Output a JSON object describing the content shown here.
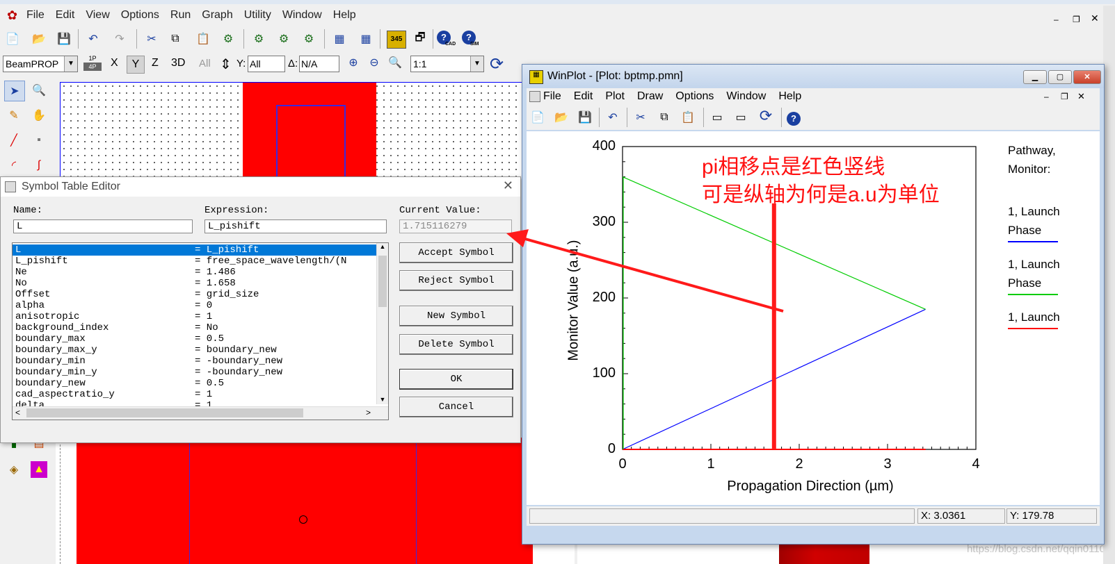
{
  "main_window": {
    "menu": [
      "File",
      "Edit",
      "View",
      "Options",
      "Run",
      "Graph",
      "Utility",
      "Window",
      "Help"
    ],
    "module_select": "BeamPROP",
    "toolbar2": {
      "p_top": "1P",
      "p_bottom": "4P",
      "x": "X",
      "y": "Y",
      "z": "Z",
      "d3": "3D",
      "all": "All",
      "y_label": "Y:",
      "y_value": "All",
      "delta_label": "Δ:",
      "delta_value": "N/A",
      "zoom_value": "1:1"
    },
    "toolbar_badges": {
      "cad": "CAD",
      "sim": "SIM",
      "counter": "345"
    }
  },
  "symbol_editor": {
    "title": "Symbol Table Editor",
    "name_label": "Name:",
    "name_value": "L",
    "expression_label": "Expression:",
    "expression_value": "L_pishift",
    "current_label": "Current Value:",
    "current_value": "1.715116279",
    "rows": [
      {
        "name": "L",
        "expr": "= L_pishift"
      },
      {
        "name": "L_pishift",
        "expr": "= free_space_wavelength/(N"
      },
      {
        "name": "Ne",
        "expr": "= 1.486"
      },
      {
        "name": "No",
        "expr": "= 1.658"
      },
      {
        "name": "Offset",
        "expr": "= grid_size"
      },
      {
        "name": "alpha",
        "expr": "= 0"
      },
      {
        "name": "anisotropic",
        "expr": "= 1"
      },
      {
        "name": "background_index",
        "expr": "= No"
      },
      {
        "name": "boundary_max",
        "expr": "= 0.5"
      },
      {
        "name": "boundary_max_y",
        "expr": "= boundary_new"
      },
      {
        "name": "boundary_min",
        "expr": "= -boundary_new"
      },
      {
        "name": "boundary_min_y",
        "expr": "= -boundary_new"
      },
      {
        "name": "boundary_new",
        "expr": "= 0.5"
      },
      {
        "name": "cad_aspectratio_y",
        "expr": "= 1"
      },
      {
        "name": "delta",
        "expr": "= 1"
      }
    ],
    "buttons": {
      "accept": "Accept Symbol",
      "reject": "Reject Symbol",
      "new": "New Symbol",
      "delete": "Delete Symbol",
      "ok": "OK",
      "cancel": "Cancel"
    }
  },
  "winplot": {
    "title": "WinPlot - [Plot: bptmp.pmn]",
    "menu": [
      "File",
      "Edit",
      "Plot",
      "Draw",
      "Options",
      "Window",
      "Help"
    ],
    "annotation_line1": "pi相移点是红色竖线",
    "annotation_line2": "可是纵轴为何是a.u为单位",
    "legend_header": [
      "Pathway,",
      "Monitor:"
    ],
    "legend": [
      {
        "line1": "1, Launch",
        "line2": "Phase",
        "color": "#0000ff"
      },
      {
        "line1": "1, Launch",
        "line2": "Phase",
        "color": "#00cc00"
      },
      {
        "line1": "1, Launch",
        "line2": "",
        "color": "#ff0000"
      }
    ],
    "status_x": "X: 3.0361",
    "status_y": "Y: 179.78"
  },
  "chart_data": {
    "type": "line",
    "xlabel": "Propagation Direction (µm)",
    "ylabel": "Monitor Value (a.u.)",
    "xlim": [
      0,
      4
    ],
    "ylim": [
      0,
      400
    ],
    "x_ticks": [
      "0",
      "1",
      "2",
      "3",
      "4"
    ],
    "y_ticks": [
      "0",
      "100",
      "200",
      "300",
      "400"
    ],
    "series": [
      {
        "color": "#0000ff",
        "x": [
          0,
          3.43
        ],
        "y": [
          0,
          185
        ]
      },
      {
        "color": "#00cc00",
        "x": [
          0,
          3.43
        ],
        "y": [
          360,
          185
        ]
      },
      {
        "color": "#ff0000",
        "x": [
          0,
          3.43
        ],
        "y": [
          0,
          0
        ]
      }
    ],
    "pi_shift_marker_x": 1.715
  },
  "watermark": "https://blog.csdn.net/qqin0110"
}
